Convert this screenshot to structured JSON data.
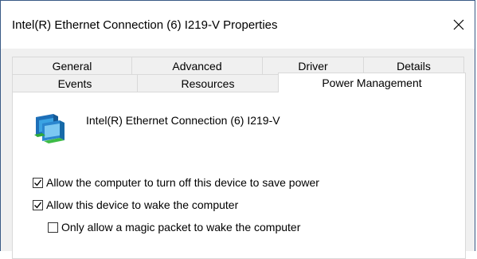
{
  "window": {
    "title": "Intel(R) Ethernet Connection (6) I219-V Properties",
    "close_glyph": "✕"
  },
  "tabs": {
    "back_row": [
      {
        "label": "General"
      },
      {
        "label": "Advanced"
      },
      {
        "label": "Driver"
      },
      {
        "label": "Details"
      }
    ],
    "front_row": [
      {
        "label": "Events"
      },
      {
        "label": "Resources"
      },
      {
        "label": "Power Management",
        "active": true
      }
    ]
  },
  "panel": {
    "device_name": "Intel(R) Ethernet Connection (6) I219-V",
    "device_icon": "network-adapter-icon",
    "options": [
      {
        "label": "Allow the computer to turn off this device to save power",
        "checked": true
      },
      {
        "label": "Allow this device to wake the computer",
        "checked": true
      },
      {
        "label": "Only allow a magic packet to wake the computer",
        "checked": false
      }
    ]
  }
}
